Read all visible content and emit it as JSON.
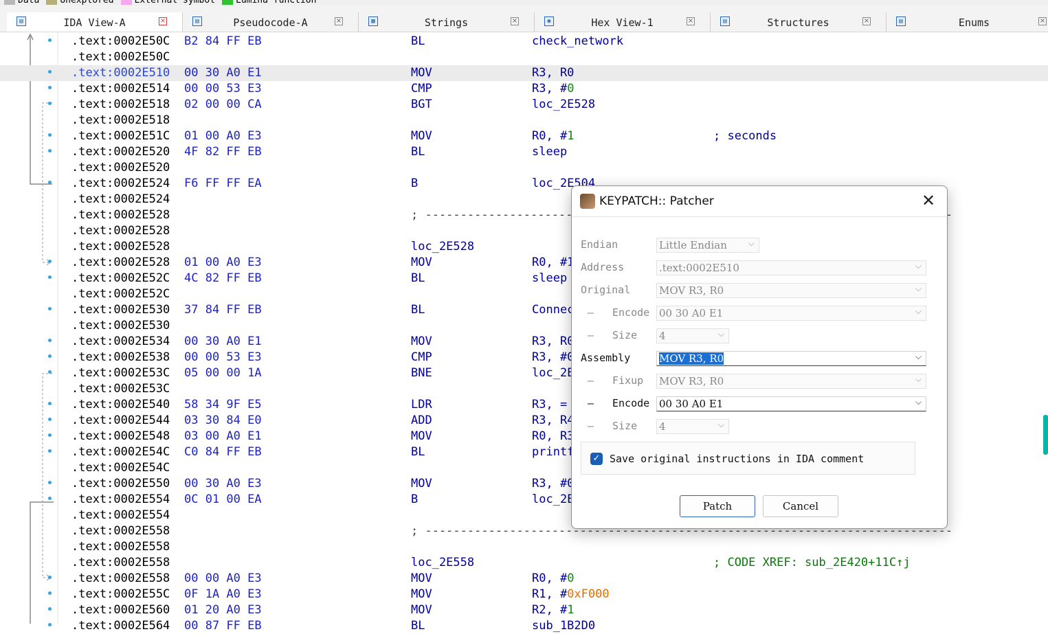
{
  "legend": [
    {
      "label": "Data",
      "color": "#b8b8b8"
    },
    {
      "label": "Unexplored",
      "color": "#b5b07a"
    },
    {
      "label": "External symbol",
      "color": "#f7a6f0"
    },
    {
      "label": "Lumina function",
      "color": "#2ec42e"
    }
  ],
  "tabs": [
    {
      "label": "IDA View-A",
      "icon": "view-icon",
      "active": true
    },
    {
      "label": "Pseudocode-A",
      "icon": "pseudocode-icon"
    },
    {
      "label": "Strings",
      "icon": "strings-icon"
    },
    {
      "label": "Hex View-1",
      "icon": "hex-icon"
    },
    {
      "label": "Structures",
      "icon": "structures-icon"
    },
    {
      "label": "Enums",
      "icon": "enums-icon"
    }
  ],
  "disasm": [
    {
      "addr": ".text:0002E50C",
      "bytes": "B2 84 FF EB",
      "mnem": "BL",
      "ops": "check_network",
      "dot": true
    },
    {
      "addr": ".text:0002E50C"
    },
    {
      "addr": ".text:0002E510",
      "bytes": "00 30 A0 E1",
      "mnem": "MOV",
      "ops": "R3, R0",
      "dot": true,
      "highlight": true
    },
    {
      "addr": ".text:0002E514",
      "bytes": "00 00 53 E3",
      "mnem": "CMP",
      "ops": "R3, #",
      "ops_num": "0",
      "dot": true
    },
    {
      "addr": ".text:0002E518",
      "bytes": "02 00 00 CA",
      "mnem": "BGT",
      "ops": "loc_2E528",
      "dot": true
    },
    {
      "addr": ".text:0002E518"
    },
    {
      "addr": ".text:0002E51C",
      "bytes": "01 00 A0 E3",
      "mnem": "MOV",
      "ops": "R0, #",
      "ops_num": "1",
      "comment": "; seconds",
      "dot": true
    },
    {
      "addr": ".text:0002E520",
      "bytes": "4F 82 FF EB",
      "mnem": "BL",
      "ops": "sleep",
      "dot": true
    },
    {
      "addr": ".text:0002E520"
    },
    {
      "addr": ".text:0002E524",
      "bytes": "F6 FF FF EA",
      "mnem": "B",
      "ops": "loc_2E504",
      "dot": true
    },
    {
      "addr": ".text:0002E524"
    },
    {
      "addr": ".text:0002E528",
      "sep": "; ---------------------------------------------------------------------------"
    },
    {
      "addr": ".text:0002E528"
    },
    {
      "addr": ".text:0002E528",
      "mnem": "loc_2E528"
    },
    {
      "addr": ".text:0002E528",
      "bytes": "01 00 A0 E3",
      "mnem": "MOV",
      "ops": "R0, #1",
      "dot": true
    },
    {
      "addr": ".text:0002E52C",
      "bytes": "4C 82 FF EB",
      "mnem": "BL",
      "ops": "sleep",
      "dot": true
    },
    {
      "addr": ".text:0002E52C"
    },
    {
      "addr": ".text:0002E530",
      "bytes": "37 84 FF EB",
      "mnem": "BL",
      "ops": "Connect",
      "dot": true
    },
    {
      "addr": ".text:0002E530"
    },
    {
      "addr": ".text:0002E534",
      "bytes": "00 30 A0 E1",
      "mnem": "MOV",
      "ops": "R3, R0",
      "dot": true
    },
    {
      "addr": ".text:0002E538",
      "bytes": "00 00 53 E3",
      "mnem": "CMP",
      "ops": "R3, #0",
      "dot": true
    },
    {
      "addr": ".text:0002E53C",
      "bytes": "05 00 00 1A",
      "mnem": "BNE",
      "ops": "loc_2E",
      "dot": true
    },
    {
      "addr": ".text:0002E53C"
    },
    {
      "addr": ".text:0002E540",
      "bytes": "58 34 9F E5",
      "mnem": "LDR",
      "ops": "R3, =",
      "dot": true
    },
    {
      "addr": ".text:0002E544",
      "bytes": "03 30 84 E0",
      "mnem": "ADD",
      "ops": "R3, R4",
      "dot": true
    },
    {
      "addr": ".text:0002E548",
      "bytes": "03 00 A0 E1",
      "mnem": "MOV",
      "ops": "R0, R3",
      "dot": true
    },
    {
      "addr": ".text:0002E54C",
      "bytes": "C0 84 FF EB",
      "mnem": "BL",
      "ops": "printf",
      "dot": true
    },
    {
      "addr": ".text:0002E54C"
    },
    {
      "addr": ".text:0002E550",
      "bytes": "00 30 A0 E3",
      "mnem": "MOV",
      "ops": "R3, #0",
      "dot": true
    },
    {
      "addr": ".text:0002E554",
      "bytes": "0C 01 00 EA",
      "mnem": "B",
      "ops": "loc_2E",
      "dot": true
    },
    {
      "addr": ".text:0002E554"
    },
    {
      "addr": ".text:0002E558",
      "sep": "; ---------------------------------------------------------------------------"
    },
    {
      "addr": ".text:0002E558"
    },
    {
      "addr": ".text:0002E558",
      "mnem": "loc_2E558",
      "comment": "; CODE XREF: sub_2E420+11C↑j",
      "comment_green": true
    },
    {
      "addr": ".text:0002E558",
      "bytes": "00 00 A0 E3",
      "mnem": "MOV",
      "ops": "R0, #",
      "ops_num": "0",
      "dot": true
    },
    {
      "addr": ".text:0002E55C",
      "bytes": "0F 1A A0 E3",
      "mnem": "MOV",
      "ops": "R1, #",
      "ops_hex": "0xF000",
      "dot": true
    },
    {
      "addr": ".text:0002E560",
      "bytes": "01 20 A0 E3",
      "mnem": "MOV",
      "ops": "R2, #",
      "ops_num": "1",
      "dot": true
    },
    {
      "addr": ".text:0002E564",
      "bytes": "00 87 FF EB",
      "mnem": "BL",
      "ops": "sub_1B2D0",
      "dot": true
    }
  ],
  "dialog": {
    "title": "KEYPATCH:: Patcher",
    "close_glyph": "✕",
    "endian_label": "Endian",
    "endian_value": "Little Endian",
    "address_label": "Address",
    "address_value": ".text:0002E510",
    "original_label": "Original",
    "original_value": "MOV R3, R0",
    "orig_encode_label": "Encode",
    "orig_encode_value": "00 30 A0 E1",
    "orig_size_label": "Size",
    "orig_size_value": "4",
    "assembly_label": "Assembly",
    "assembly_value": "MOV R3, R0",
    "fixup_label": "Fixup",
    "fixup_value": "MOV R3, R0",
    "new_encode_label": "Encode",
    "new_encode_value": "00 30 A0 E1",
    "new_size_label": "Size",
    "new_size_value": "4",
    "dash": "–",
    "checkbox_label": "Save original instructions in IDA comment",
    "checkbox_checked": true,
    "patch_button": "Patch",
    "cancel_button": "Cancel",
    "dropdown_arrow": "⌵"
  }
}
